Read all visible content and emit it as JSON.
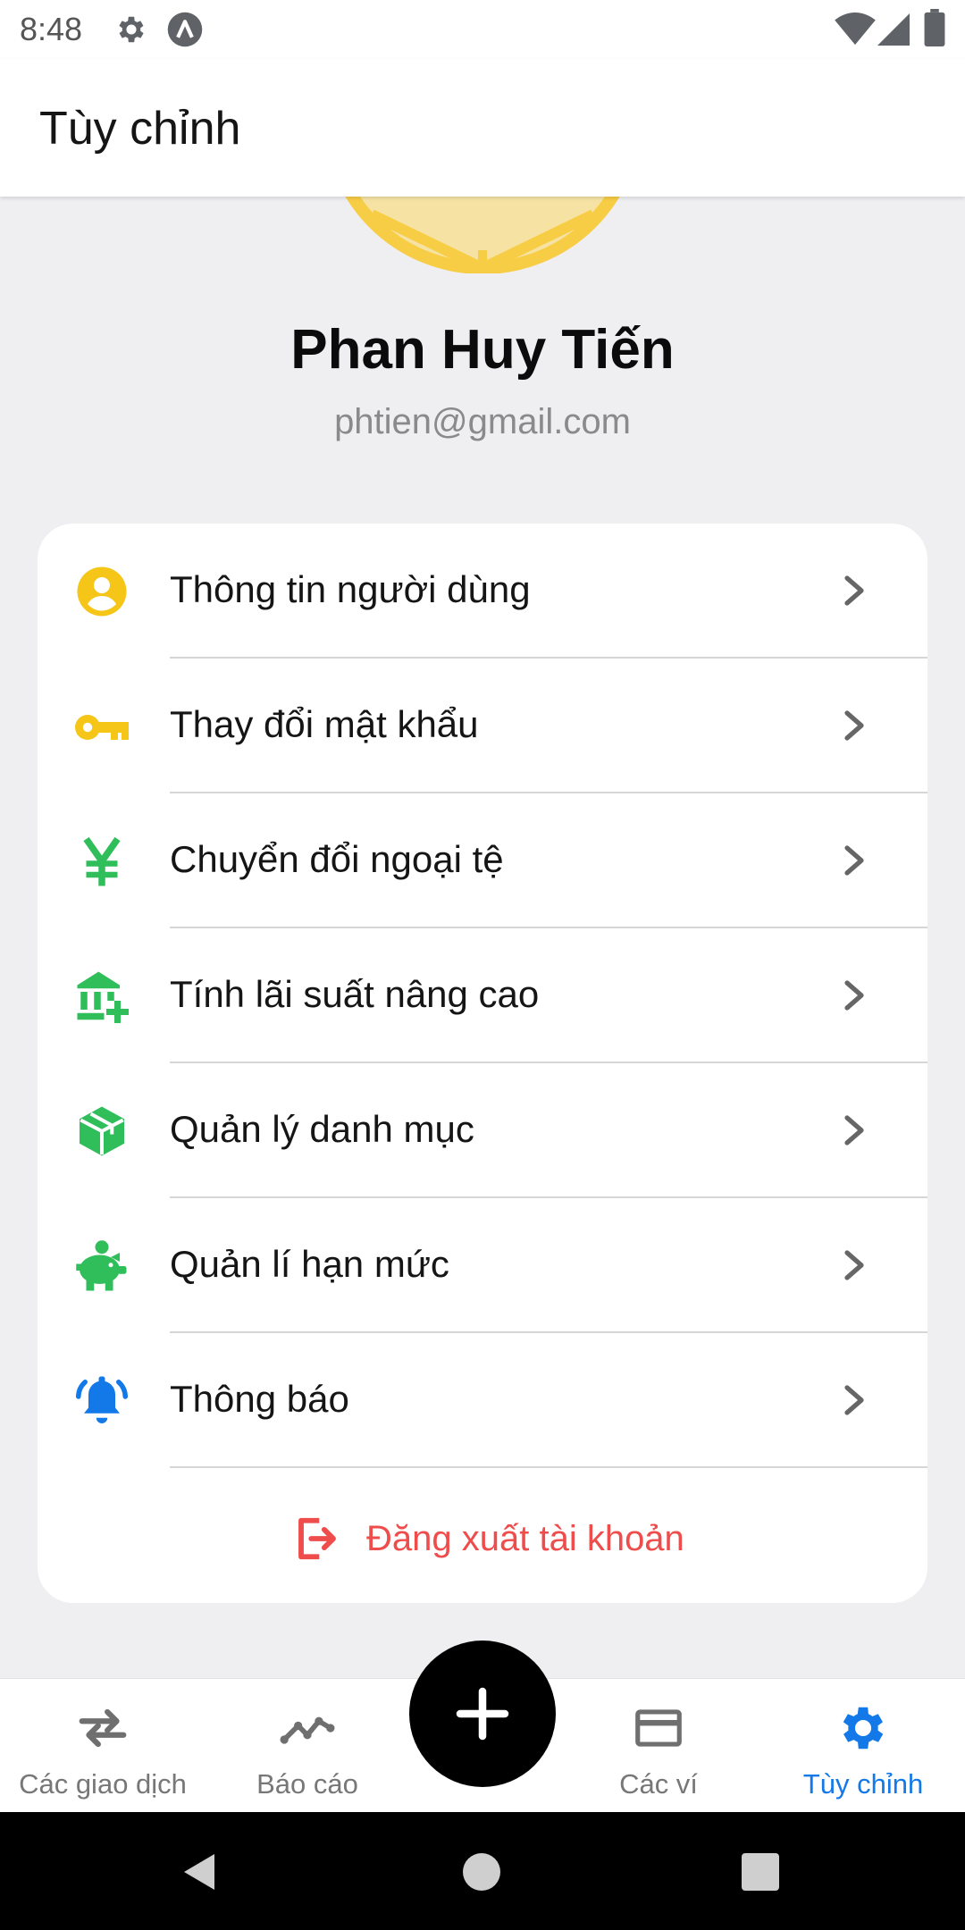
{
  "status_bar": {
    "time": "8:48",
    "icons": [
      "gear-icon",
      "a-icon",
      "wifi-icon",
      "signal-icon",
      "battery-icon"
    ]
  },
  "app_bar": {
    "title": "Tùy chỉnh"
  },
  "profile": {
    "name": "Phan Huy Tiến",
    "email": "phtien@gmail.com"
  },
  "menu": {
    "items": [
      {
        "label": "Thông tin người dùng",
        "icon": "user-circle-icon",
        "color": "#f5c518"
      },
      {
        "label": "Thay đổi mật khẩu",
        "icon": "key-icon",
        "color": "#f5c518"
      },
      {
        "label": "Chuyển đổi ngoại tệ",
        "icon": "yen-icon",
        "color": "#2fbe5a"
      },
      {
        "label": "Tính lãi suất nâng cao",
        "icon": "bank-plus-icon",
        "color": "#2fbe5a"
      },
      {
        "label": "Quản lý danh mục",
        "icon": "box-icon",
        "color": "#2fbe5a"
      },
      {
        "label": "Quản lí hạn mức",
        "icon": "piggy-bank-icon",
        "color": "#2fbe5a"
      },
      {
        "label": "Thông báo",
        "icon": "bell-icon",
        "color": "#1479e8"
      }
    ],
    "logout_label": "Đăng xuất tài khoản",
    "logout_color": "#ef4c4c"
  },
  "bottom_nav": {
    "items": [
      {
        "label": "Các giao dịch",
        "icon": "swap-arrows-icon"
      },
      {
        "label": "Báo cáo",
        "icon": "line-chart-icon"
      },
      {
        "label": "Các ví",
        "icon": "wallet-card-icon"
      },
      {
        "label": "Tùy chỉnh",
        "icon": "settings-gear-icon",
        "active": true
      }
    ],
    "fab_icon": "plus-icon",
    "active_color": "#1479e8"
  },
  "system_nav": {
    "icons": [
      "back-icon",
      "home-icon",
      "recents-icon"
    ]
  }
}
